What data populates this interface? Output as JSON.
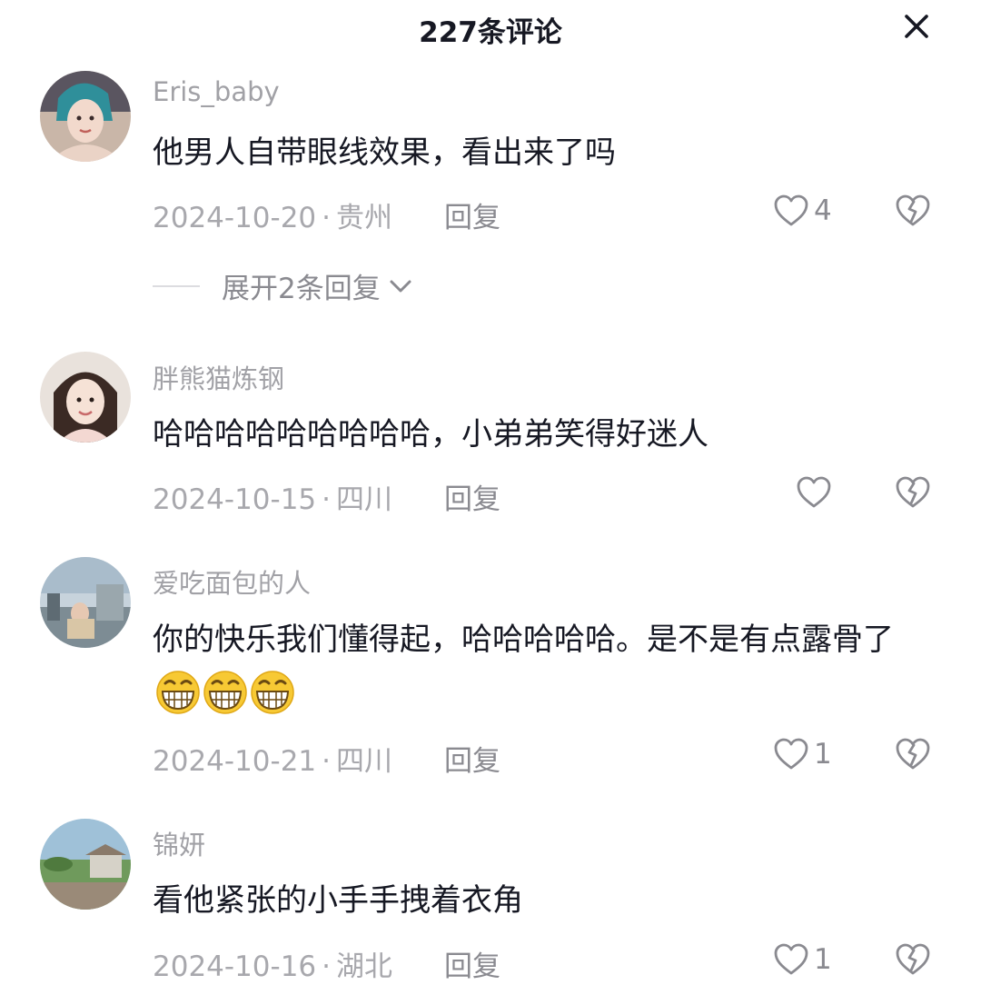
{
  "header": {
    "title": "227条评论",
    "close_icon": "close-icon"
  },
  "comments": [
    {
      "username": "Eris_baby",
      "text": "他男人自带眼线效果，看出来了吗",
      "date": "2024-10-20",
      "separator": "·",
      "location": "贵州",
      "reply_label": "回复",
      "likes": "4",
      "expand_label": "展开2条回复"
    },
    {
      "username": "胖熊猫炼钢",
      "text": "哈哈哈哈哈哈哈哈哈，小弟弟笑得好迷人",
      "date": "2024-10-15",
      "separator": "·",
      "location": "四川",
      "reply_label": "回复",
      "likes": ""
    },
    {
      "username": "爱吃面包的人",
      "text": "你的快乐我们懂得起，哈哈哈哈哈。是不是有点露骨了",
      "emoji_icons": [
        "grin-emoji",
        "grin-emoji",
        "grin-emoji"
      ],
      "date": "2024-10-21",
      "separator": "·",
      "location": "四川",
      "reply_label": "回复",
      "likes": "1"
    },
    {
      "username": "锦妍",
      "text": "看他紧张的小手手拽着衣角",
      "date": "2024-10-16",
      "separator": "·",
      "location": "湖北",
      "reply_label": "回复",
      "likes": "1"
    }
  ],
  "colors": {
    "text_primary": "#161823",
    "text_secondary": "#a1a1a6",
    "icon_gray": "#8a8a90",
    "emoji_yellow": "#f7c934"
  }
}
